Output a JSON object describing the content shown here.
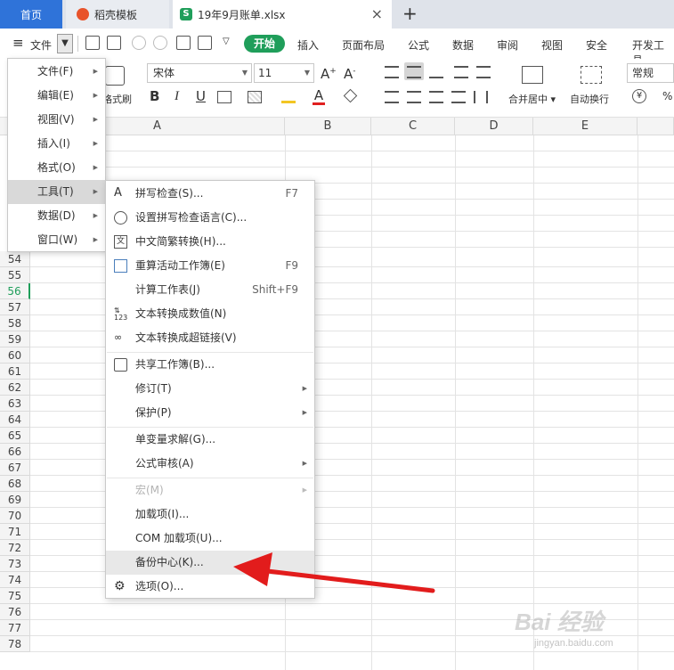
{
  "tabs": {
    "home": "首页",
    "template": "稻壳模板",
    "file": "19年9月账单.xlsx",
    "add": "+"
  },
  "menubar": {
    "file": "文件",
    "start": "开始",
    "items": [
      "插入",
      "页面布局",
      "公式",
      "数据",
      "审阅",
      "视图",
      "安全",
      "开发工具"
    ]
  },
  "ribbon": {
    "font": "宋体",
    "size": "11",
    "format_brush": "格式刷",
    "bold": "B",
    "italic": "I",
    "underline": "U",
    "font_grow": "A+",
    "font_shrink": "A-",
    "merge_center": "合并居中",
    "wrap_text": "自动换行",
    "number_format": "常规"
  },
  "columns": [
    "A",
    "B",
    "C",
    "D",
    "E"
  ],
  "rows": [
    "54",
    "55",
    "56",
    "57",
    "58",
    "59",
    "60",
    "61",
    "62",
    "63",
    "64",
    "65",
    "66",
    "67",
    "68",
    "69",
    "70",
    "71",
    "72",
    "73",
    "74",
    "75",
    "76",
    "77",
    "78"
  ],
  "active_row": "56",
  "main_menu": {
    "items": [
      {
        "label": "文件(F)"
      },
      {
        "label": "编辑(E)"
      },
      {
        "label": "视图(V)"
      },
      {
        "label": "插入(I)"
      },
      {
        "label": "格式(O)"
      },
      {
        "label": "工具(T)"
      },
      {
        "label": "数据(D)"
      },
      {
        "label": "窗口(W)"
      }
    ],
    "hovered": "工具(T)"
  },
  "tools_menu": {
    "items": [
      {
        "label": "拼写检查(S)...",
        "shortcut": "F7",
        "icon": "spellcheck-icon"
      },
      {
        "label": "设置拼写检查语言(C)...",
        "shortcut": "",
        "icon": "language-globe-icon"
      },
      {
        "label": "中文简繁转换(H)...",
        "shortcut": "",
        "icon": "chinese-convert-icon"
      },
      {
        "label": "重算活动工作簿(E)",
        "shortcut": "F9",
        "icon": "recalc-workbook-icon"
      },
      {
        "label": "计算工作表(J)",
        "shortcut": "Shift+F9",
        "icon": ""
      },
      {
        "label": "文本转换成数值(N)",
        "shortcut": "",
        "icon": "text-to-number-icon"
      },
      {
        "label": "文本转换成超链接(V)",
        "shortcut": "",
        "icon": "text-to-link-icon"
      },
      {
        "label": "共享工作簿(B)...",
        "shortcut": "",
        "icon": "share-workbook-icon"
      },
      {
        "label": "修订(T)",
        "shortcut": "",
        "icon": ""
      },
      {
        "label": "保护(P)",
        "shortcut": "",
        "icon": ""
      },
      {
        "label": "单变量求解(G)...",
        "shortcut": "",
        "icon": ""
      },
      {
        "label": "公式审核(A)",
        "shortcut": "",
        "icon": ""
      },
      {
        "label": "宏(M)",
        "shortcut": "",
        "icon": ""
      },
      {
        "label": "加载项(I)...",
        "shortcut": "",
        "icon": ""
      },
      {
        "label": "COM 加载项(U)...",
        "shortcut": "",
        "icon": ""
      },
      {
        "label": "备份中心(K)...",
        "shortcut": "",
        "icon": ""
      },
      {
        "label": "选项(O)...",
        "shortcut": "",
        "icon": "gear-icon"
      }
    ]
  },
  "watermark": {
    "brand": "Bai 经验",
    "url": "jingyan.baidu.com"
  },
  "colors": {
    "accent_green": "#1f9e5a",
    "home_tab_blue": "#2f73d9",
    "arrow_red": "#e21c1c"
  }
}
